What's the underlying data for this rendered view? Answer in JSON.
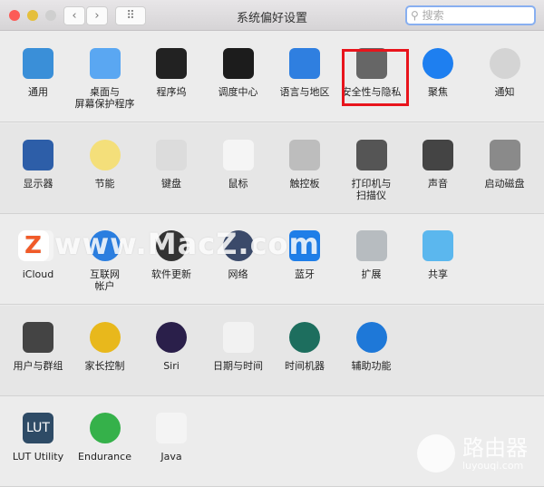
{
  "window": {
    "title": "系统偏好设置",
    "search_placeholder": "搜索",
    "back": "‹",
    "forward": "›",
    "grid": "⠿"
  },
  "colors": {
    "close": "#fc5b57",
    "minimize": "#e5bf3c",
    "zoom": "#cfcfcf",
    "highlight": "#e8141c"
  },
  "sections": [
    [
      {
        "label": "通用",
        "icon": "general-icon",
        "color": "#3a8fd8"
      },
      {
        "label": "桌面与\n屏幕保护程序",
        "icon": "desktop-icon",
        "color": "#5aa7f2"
      },
      {
        "label": "程序坞",
        "icon": "dock-icon",
        "color": "#222"
      },
      {
        "label": "调度中心",
        "icon": "mission-control-icon",
        "color": "#1c1c1c"
      },
      {
        "label": "语言与地区",
        "icon": "flag-icon",
        "color": "#2f7fe0"
      },
      {
        "label": "安全性与隐私",
        "icon": "security-house-icon",
        "color": "#666"
      },
      {
        "label": "聚焦",
        "icon": "spotlight-icon",
        "color": "#1e7ff0"
      },
      {
        "label": "通知",
        "icon": "notifications-icon",
        "color": "#d4d4d4"
      }
    ],
    [
      {
        "label": "显示器",
        "icon": "display-icon",
        "color": "#2d5ea8"
      },
      {
        "label": "节能",
        "icon": "bulb-icon",
        "color": "#f4df7a"
      },
      {
        "label": "键盘",
        "icon": "keyboard-icon",
        "color": "#dcdcdc"
      },
      {
        "label": "鼠标",
        "icon": "mouse-icon",
        "color": "#f5f5f5"
      },
      {
        "label": "触控板",
        "icon": "trackpad-icon",
        "color": "#bdbdbd"
      },
      {
        "label": "打印机与\n扫描仪",
        "icon": "printer-icon",
        "color": "#555"
      },
      {
        "label": "声音",
        "icon": "speaker-icon",
        "color": "#444"
      },
      {
        "label": "启动磁盘",
        "icon": "disk-icon",
        "color": "#8a8a8a"
      }
    ],
    [
      {
        "label": "iCloud",
        "icon": "icloud-icon",
        "color": "#f4f4f4"
      },
      {
        "label": "互联网\n帐户",
        "icon": "at-icon",
        "color": "#2a7ee0"
      },
      {
        "label": "软件更新",
        "icon": "gear-icon",
        "color": "#333"
      },
      {
        "label": "网络",
        "icon": "globe-icon",
        "color": "#3b4a6a"
      },
      {
        "label": "蓝牙",
        "icon": "bluetooth-icon",
        "color": "#1f7ee8"
      },
      {
        "label": "扩展",
        "icon": "puzzle-icon",
        "color": "#b7bcc0"
      },
      {
        "label": "共享",
        "icon": "folder-icon",
        "color": "#5bb7ee"
      }
    ],
    [
      {
        "label": "用户与群组",
        "icon": "users-icon",
        "color": "#444"
      },
      {
        "label": "家长控制",
        "icon": "parental-icon",
        "color": "#e8b81c"
      },
      {
        "label": "Siri",
        "icon": "siri-icon",
        "color": "#2a1f4a"
      },
      {
        "label": "日期与时间",
        "icon": "clock-icon",
        "color": "#f2f2f2"
      },
      {
        "label": "时间机器",
        "icon": "time-machine-icon",
        "color": "#1d6e5e"
      },
      {
        "label": "辅助功能",
        "icon": "accessibility-icon",
        "color": "#1e78d8"
      }
    ],
    [
      {
        "label": "LUT Utility",
        "icon": "lut-icon",
        "color": "#2e4b66",
        "text": "LUT"
      },
      {
        "label": "Endurance",
        "icon": "battery-icon",
        "color": "#35b14a"
      },
      {
        "label": "Java",
        "icon": "java-icon",
        "color": "#f4f4f4"
      }
    ]
  ],
  "watermarks": {
    "macz": "www.MacZ.com",
    "macz_logo": "Z",
    "luyouqi_cn": "路由器",
    "luyouqi_en": "luyouqi.com"
  }
}
